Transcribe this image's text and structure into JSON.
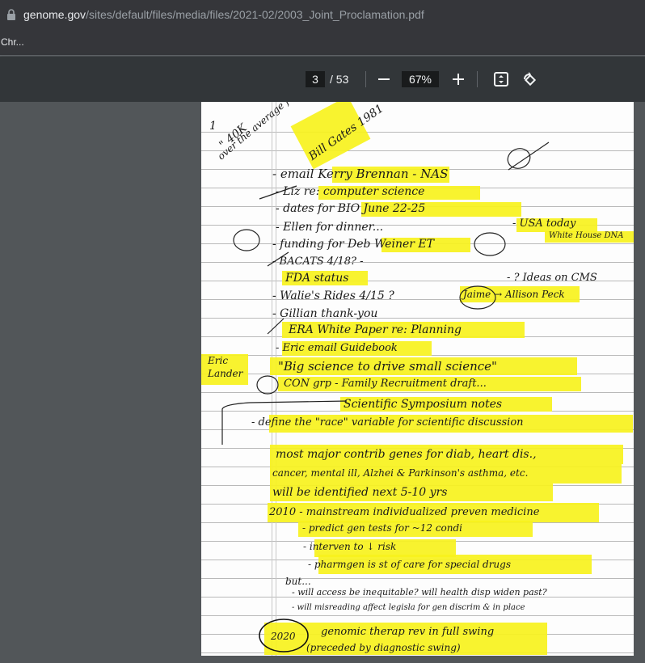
{
  "browser": {
    "url_host": "genome.gov",
    "url_path": "/sites/default/files/media/files/2021-02/2003_Joint_Proclamation.pdf",
    "bookmark": "Chr..."
  },
  "pdf_toolbar": {
    "current_page": "3",
    "total_pages": "/ 53",
    "zoom": "67%"
  },
  "notes": {
    "top_margin": [
      "\" 40K",
      "over the average for anybody\"",
      "Bill Gates 1981"
    ],
    "lines": [
      "- email Kerry Brennan - NAS",
      "- Liz re: computer science",
      "- dates for BIO June 22-25",
      "- Ellen for dinner...",
      "- USA today",
      "White House DNA",
      "- funding for Deb Weiner ET",
      "- BACATS 4/18? -",
      "FDA status",
      "- ? Ideas on CMS",
      "- Walie's Rides 4/15 ?",
      "Jaime → Allison Peck",
      "- Gillian thank-you",
      "ERA White Paper re: Planning",
      "- Eric email Guidebook",
      "Eric Lander",
      "\"Big science to drive small science\"",
      "CON grp - Family Recruitment draft...",
      "Scientific Symposium notes",
      "- define the \"race\" variable for scientific discussion",
      "most major contrib genes for diab, heart dis.,",
      "cancer, mental ill, Alzhei & Parkinson's asthma, etc.",
      "will be identified next 5-10 yrs",
      "2010 - mainstream individualized preven medicine",
      "- predict gen tests for ~12 condi",
      "- interven to ↓ risk",
      "- pharmgen is st of care for special drugs",
      "but...",
      "- will access be inequitable? will health disp widen past?",
      "- will misreading affect legisla for gen discrim & in place",
      "2020",
      "genomic therap rev in full swing",
      "(preceded by diagnostic swing)"
    ]
  }
}
